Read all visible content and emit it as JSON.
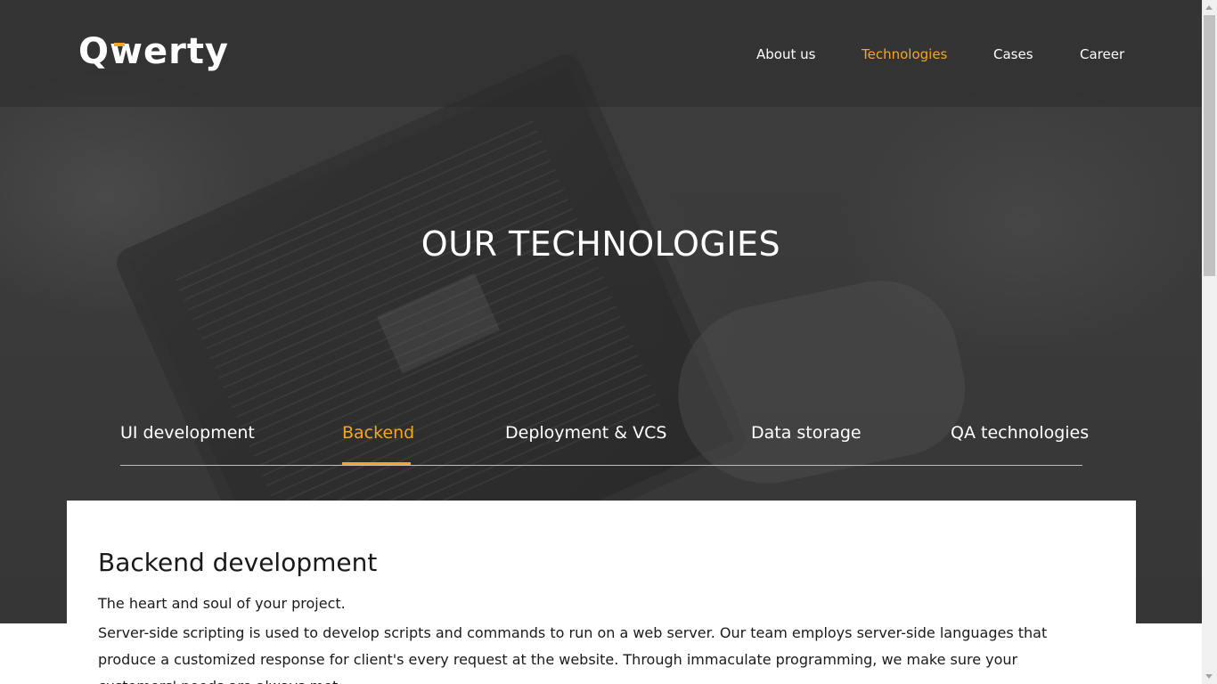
{
  "colors": {
    "accent": "#f5a623",
    "hero_bg": "#3a3a3a",
    "text_light": "#ffffff",
    "text_dark": "#1a1a1a"
  },
  "brand": {
    "logo_text": "Qwerty"
  },
  "nav": {
    "items": [
      {
        "label": "About us",
        "active": false
      },
      {
        "label": "Technologies",
        "active": true
      },
      {
        "label": "Cases",
        "active": false
      },
      {
        "label": "Career",
        "active": false
      }
    ]
  },
  "hero": {
    "title": "OUR TECHNOLOGIES"
  },
  "tabs": {
    "items": [
      {
        "label": "UI development",
        "active": false
      },
      {
        "label": "Backend",
        "active": true
      },
      {
        "label": "Deployment & VCS",
        "active": false
      },
      {
        "label": "Data storage",
        "active": false
      },
      {
        "label": "QA technologies",
        "active": false
      }
    ]
  },
  "content": {
    "title": "Backend development",
    "lead": "The heart and soul of your project.",
    "body": "Server-side scripting is used to develop scripts and commands to run on a web server. Our team employs server-side languages that produce a customized response for client's every request at the website. Through immaculate programming, we make sure your customers' needs are always met."
  }
}
